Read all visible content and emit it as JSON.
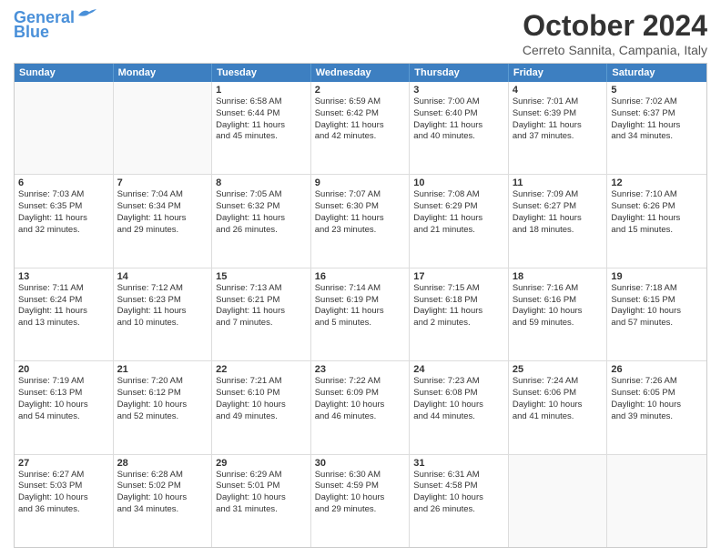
{
  "header": {
    "logo_line1": "General",
    "logo_line2": "Blue",
    "month": "October 2024",
    "location": "Cerreto Sannita, Campania, Italy"
  },
  "days_of_week": [
    "Sunday",
    "Monday",
    "Tuesday",
    "Wednesday",
    "Thursday",
    "Friday",
    "Saturday"
  ],
  "weeks": [
    [
      {
        "day": "",
        "lines": []
      },
      {
        "day": "",
        "lines": []
      },
      {
        "day": "1",
        "lines": [
          "Sunrise: 6:58 AM",
          "Sunset: 6:44 PM",
          "Daylight: 11 hours",
          "and 45 minutes."
        ]
      },
      {
        "day": "2",
        "lines": [
          "Sunrise: 6:59 AM",
          "Sunset: 6:42 PM",
          "Daylight: 11 hours",
          "and 42 minutes."
        ]
      },
      {
        "day": "3",
        "lines": [
          "Sunrise: 7:00 AM",
          "Sunset: 6:40 PM",
          "Daylight: 11 hours",
          "and 40 minutes."
        ]
      },
      {
        "day": "4",
        "lines": [
          "Sunrise: 7:01 AM",
          "Sunset: 6:39 PM",
          "Daylight: 11 hours",
          "and 37 minutes."
        ]
      },
      {
        "day": "5",
        "lines": [
          "Sunrise: 7:02 AM",
          "Sunset: 6:37 PM",
          "Daylight: 11 hours",
          "and 34 minutes."
        ]
      }
    ],
    [
      {
        "day": "6",
        "lines": [
          "Sunrise: 7:03 AM",
          "Sunset: 6:35 PM",
          "Daylight: 11 hours",
          "and 32 minutes."
        ]
      },
      {
        "day": "7",
        "lines": [
          "Sunrise: 7:04 AM",
          "Sunset: 6:34 PM",
          "Daylight: 11 hours",
          "and 29 minutes."
        ]
      },
      {
        "day": "8",
        "lines": [
          "Sunrise: 7:05 AM",
          "Sunset: 6:32 PM",
          "Daylight: 11 hours",
          "and 26 minutes."
        ]
      },
      {
        "day": "9",
        "lines": [
          "Sunrise: 7:07 AM",
          "Sunset: 6:30 PM",
          "Daylight: 11 hours",
          "and 23 minutes."
        ]
      },
      {
        "day": "10",
        "lines": [
          "Sunrise: 7:08 AM",
          "Sunset: 6:29 PM",
          "Daylight: 11 hours",
          "and 21 minutes."
        ]
      },
      {
        "day": "11",
        "lines": [
          "Sunrise: 7:09 AM",
          "Sunset: 6:27 PM",
          "Daylight: 11 hours",
          "and 18 minutes."
        ]
      },
      {
        "day": "12",
        "lines": [
          "Sunrise: 7:10 AM",
          "Sunset: 6:26 PM",
          "Daylight: 11 hours",
          "and 15 minutes."
        ]
      }
    ],
    [
      {
        "day": "13",
        "lines": [
          "Sunrise: 7:11 AM",
          "Sunset: 6:24 PM",
          "Daylight: 11 hours",
          "and 13 minutes."
        ]
      },
      {
        "day": "14",
        "lines": [
          "Sunrise: 7:12 AM",
          "Sunset: 6:23 PM",
          "Daylight: 11 hours",
          "and 10 minutes."
        ]
      },
      {
        "day": "15",
        "lines": [
          "Sunrise: 7:13 AM",
          "Sunset: 6:21 PM",
          "Daylight: 11 hours",
          "and 7 minutes."
        ]
      },
      {
        "day": "16",
        "lines": [
          "Sunrise: 7:14 AM",
          "Sunset: 6:19 PM",
          "Daylight: 11 hours",
          "and 5 minutes."
        ]
      },
      {
        "day": "17",
        "lines": [
          "Sunrise: 7:15 AM",
          "Sunset: 6:18 PM",
          "Daylight: 11 hours",
          "and 2 minutes."
        ]
      },
      {
        "day": "18",
        "lines": [
          "Sunrise: 7:16 AM",
          "Sunset: 6:16 PM",
          "Daylight: 10 hours",
          "and 59 minutes."
        ]
      },
      {
        "day": "19",
        "lines": [
          "Sunrise: 7:18 AM",
          "Sunset: 6:15 PM",
          "Daylight: 10 hours",
          "and 57 minutes."
        ]
      }
    ],
    [
      {
        "day": "20",
        "lines": [
          "Sunrise: 7:19 AM",
          "Sunset: 6:13 PM",
          "Daylight: 10 hours",
          "and 54 minutes."
        ]
      },
      {
        "day": "21",
        "lines": [
          "Sunrise: 7:20 AM",
          "Sunset: 6:12 PM",
          "Daylight: 10 hours",
          "and 52 minutes."
        ]
      },
      {
        "day": "22",
        "lines": [
          "Sunrise: 7:21 AM",
          "Sunset: 6:10 PM",
          "Daylight: 10 hours",
          "and 49 minutes."
        ]
      },
      {
        "day": "23",
        "lines": [
          "Sunrise: 7:22 AM",
          "Sunset: 6:09 PM",
          "Daylight: 10 hours",
          "and 46 minutes."
        ]
      },
      {
        "day": "24",
        "lines": [
          "Sunrise: 7:23 AM",
          "Sunset: 6:08 PM",
          "Daylight: 10 hours",
          "and 44 minutes."
        ]
      },
      {
        "day": "25",
        "lines": [
          "Sunrise: 7:24 AM",
          "Sunset: 6:06 PM",
          "Daylight: 10 hours",
          "and 41 minutes."
        ]
      },
      {
        "day": "26",
        "lines": [
          "Sunrise: 7:26 AM",
          "Sunset: 6:05 PM",
          "Daylight: 10 hours",
          "and 39 minutes."
        ]
      }
    ],
    [
      {
        "day": "27",
        "lines": [
          "Sunrise: 6:27 AM",
          "Sunset: 5:03 PM",
          "Daylight: 10 hours",
          "and 36 minutes."
        ]
      },
      {
        "day": "28",
        "lines": [
          "Sunrise: 6:28 AM",
          "Sunset: 5:02 PM",
          "Daylight: 10 hours",
          "and 34 minutes."
        ]
      },
      {
        "day": "29",
        "lines": [
          "Sunrise: 6:29 AM",
          "Sunset: 5:01 PM",
          "Daylight: 10 hours",
          "and 31 minutes."
        ]
      },
      {
        "day": "30",
        "lines": [
          "Sunrise: 6:30 AM",
          "Sunset: 4:59 PM",
          "Daylight: 10 hours",
          "and 29 minutes."
        ]
      },
      {
        "day": "31",
        "lines": [
          "Sunrise: 6:31 AM",
          "Sunset: 4:58 PM",
          "Daylight: 10 hours",
          "and 26 minutes."
        ]
      },
      {
        "day": "",
        "lines": []
      },
      {
        "day": "",
        "lines": []
      }
    ]
  ]
}
